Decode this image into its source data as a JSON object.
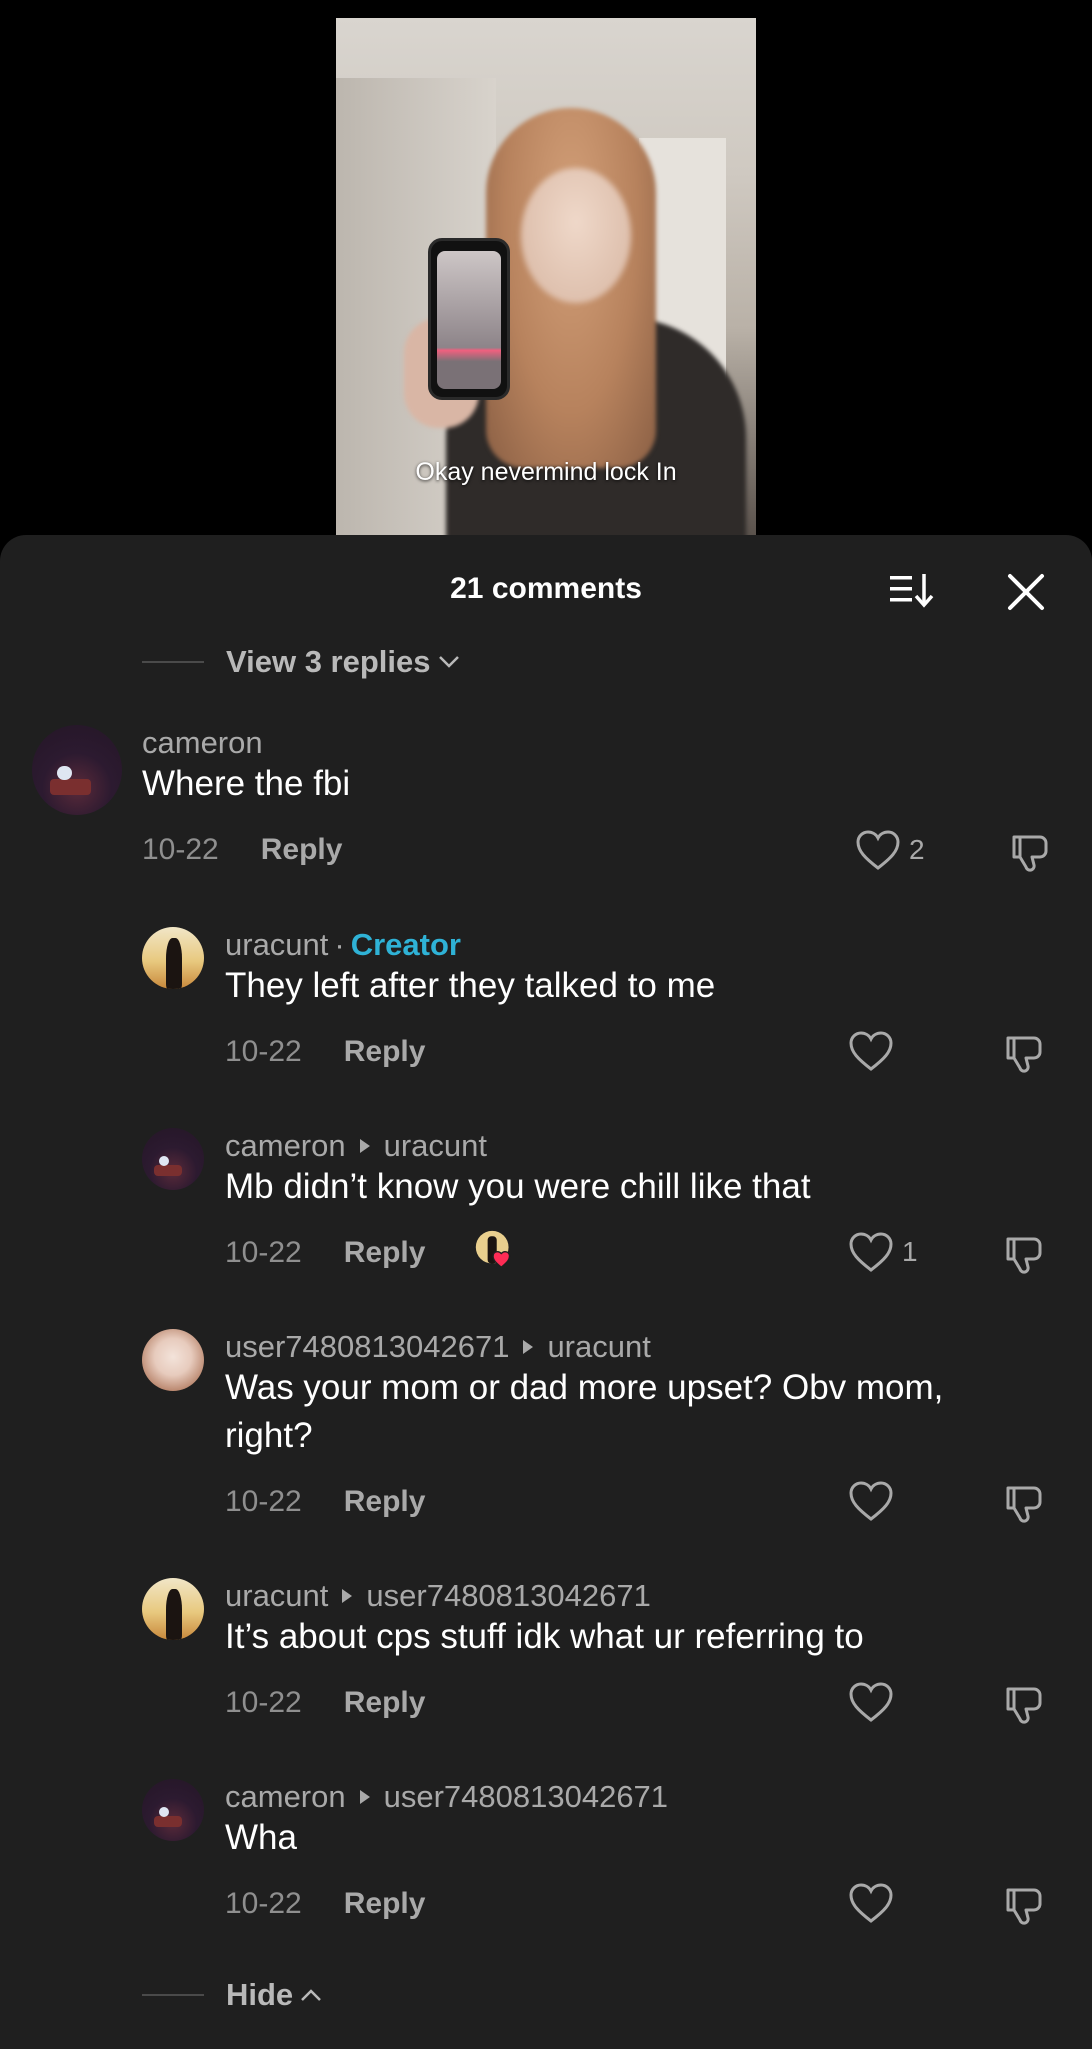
{
  "video": {
    "caption": "Okay nevermind lock In"
  },
  "header": {
    "title": "21 comments",
    "sort_icon": "sort-icon",
    "close_icon": "close-icon"
  },
  "view_replies": {
    "label": "View 3 replies"
  },
  "comments": [
    {
      "username": "cameron",
      "text": "Where the fbi",
      "date": "10-22",
      "reply_label": "Reply",
      "likes": "2"
    }
  ],
  "replies": [
    {
      "username": "uracunt",
      "separator": "·",
      "badge": "Creator",
      "text": "They left after they talked to me",
      "date": "10-22",
      "reply_label": "Reply"
    },
    {
      "username": "cameron",
      "reply_to": "uracunt",
      "text": "Mb didn’t know you were chill like that",
      "date": "10-22",
      "reply_label": "Reply",
      "likes": "1"
    },
    {
      "username": "user7480813042671",
      "reply_to": "uracunt",
      "text_line1": "Was your mom or dad more upset? Obv mom,",
      "text_line2": "right?",
      "date": "10-22",
      "reply_label": "Reply"
    },
    {
      "username": "uracunt",
      "reply_to": "user7480813042671",
      "text": "It’s about cps stuff idk what ur referring to",
      "date": "10-22",
      "reply_label": "Reply"
    },
    {
      "username": "cameron",
      "reply_to": "user7480813042671",
      "text": "Wha",
      "date": "10-22",
      "reply_label": "Reply"
    }
  ],
  "hide_replies": {
    "label": "Hide"
  },
  "colors": {
    "sheet_bg": "#1f1f1f",
    "creator_badge": "#2fb2d6",
    "liked_heart": "#fe2c55"
  }
}
